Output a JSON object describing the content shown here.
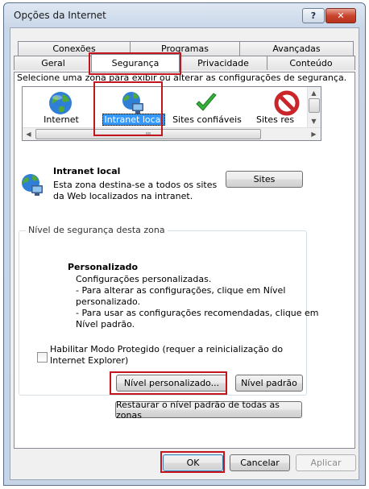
{
  "window": {
    "title": "Opções da Internet",
    "help_label": "?",
    "close_label": "✕"
  },
  "tabs_row1": [
    "Conexões",
    "Programas",
    "Avançadas"
  ],
  "tabs_row2": [
    "Geral",
    "Segurança",
    "Privacidade",
    "Conteúdo"
  ],
  "active_tab": "Segurança",
  "security": {
    "instruction": "Selecione uma zona para exibir ou alterar as configurações de segurança.",
    "zones": [
      {
        "label": "Internet",
        "icon": "globe-icon"
      },
      {
        "label": "Intranet local",
        "icon": "intranet-icon",
        "selected": true
      },
      {
        "label": "Sites confiáveis",
        "icon": "checkmark-icon"
      },
      {
        "label": "Sites res",
        "icon": "restricted-icon"
      }
    ],
    "scroll_thumb_label": "III",
    "zone_detail": {
      "title": "Intranet local",
      "line1": "Esta zona destina-se a todos os sites",
      "line2": "da Web localizados na intranet."
    },
    "sites_button": "Sites",
    "group_title": "Nível de segurança desta zona",
    "level": {
      "title": "Personalizado",
      "line1": "Configurações personalizadas.",
      "line2": "- Para alterar as configurações, clique em Nível",
      "line3": "personalizado.",
      "line4": "- Para usar as configurações recomendadas, clique em",
      "line5": "Nível padrão."
    },
    "protected_mode": {
      "checked": false,
      "line1": "Habilitar Modo Protegido (requer a reinicialização do",
      "line2": "Internet Explorer)"
    },
    "custom_level_button": "Nível personalizado...",
    "default_level_button": "Nível padrão",
    "reset_all_button": "Restaurar o nível padrão de todas as zonas"
  },
  "footer": {
    "ok": "OK",
    "cancel": "Cancelar",
    "apply": "Aplicar"
  },
  "colors": {
    "highlight": "#c2151e",
    "selection": "#3399ff"
  }
}
